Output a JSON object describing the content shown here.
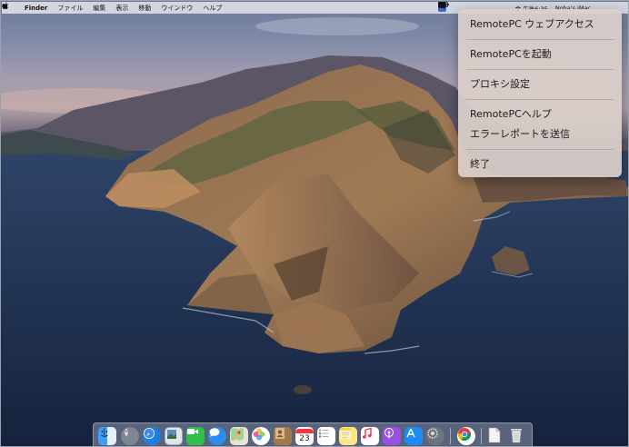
{
  "menubar": {
    "app_name": "Finder",
    "items": [
      "ファイル",
      "編集",
      "表示",
      "移動",
      "ウインドウ",
      "ヘルプ"
    ],
    "clock": "金 午後6:35",
    "user": "Noha's iMac",
    "status_icons": [
      "remotepc-icon",
      "wifi-icon",
      "airplay-icon",
      "input-source-icon",
      "battery-icon"
    ]
  },
  "remotepc_menu": {
    "items": [
      "RemotePC ウェブアクセス",
      "RemotePCを起動",
      "プロキシ設定",
      "RemotePCヘルプ",
      "エラーレポートを送信",
      "終了"
    ]
  },
  "dock": {
    "apps": [
      "finder-icon",
      "launchpad-icon",
      "safari-icon",
      "preview-icon",
      "facetime-icon",
      "messages-icon",
      "maps-icon",
      "photos-icon",
      "contacts-icon",
      "calendar-icon",
      "reminders-icon",
      "notes-icon",
      "music-icon",
      "podcasts-icon",
      "app-store-icon",
      "system-preferences-icon",
      "chrome-icon",
      "documents-icon",
      "trash-icon"
    ],
    "calendar_day": "23"
  }
}
